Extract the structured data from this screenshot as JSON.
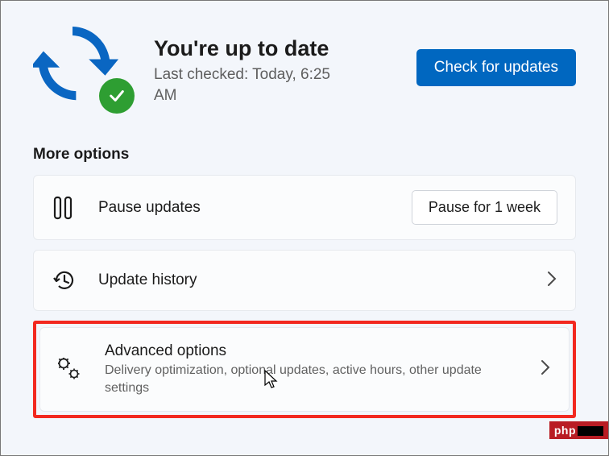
{
  "header": {
    "title": "You're up to date",
    "subtitle": "Last checked: Today, 6:25 AM",
    "check_button": "Check for updates"
  },
  "section_heading": "More options",
  "pause": {
    "title": "Pause updates",
    "button": "Pause for 1 week"
  },
  "history": {
    "title": "Update history"
  },
  "advanced": {
    "title": "Advanced options",
    "subtitle": "Delivery optimization, optional updates, active hours, other update settings"
  },
  "watermark": "php",
  "colors": {
    "accent": "#0067c0",
    "success": "#2e9e32",
    "highlight": "#f2281f"
  }
}
